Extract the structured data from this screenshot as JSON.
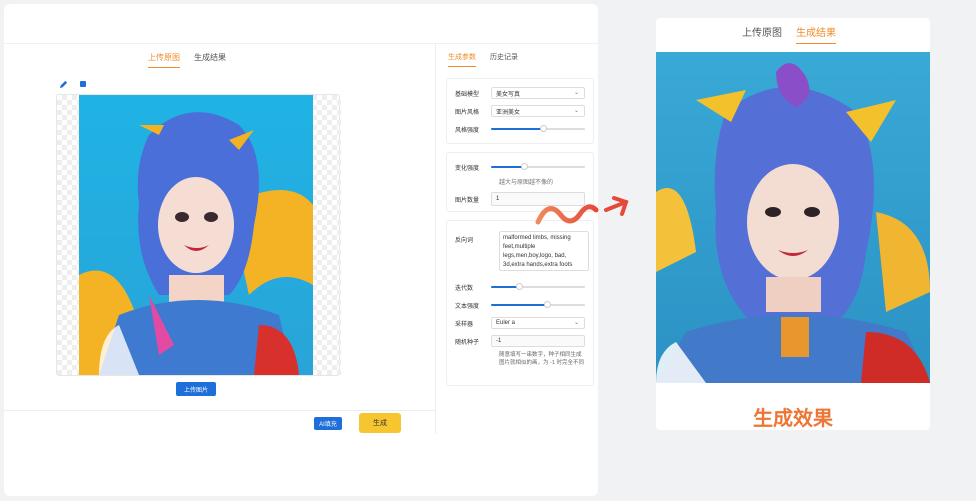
{
  "editor": {
    "tabs": [
      {
        "label": "上传原图",
        "active": true
      },
      {
        "label": "生成结果",
        "active": false
      }
    ],
    "tools": [
      {
        "icon": "pencil-icon"
      },
      {
        "icon": "stop-square-icon"
      }
    ],
    "upload_label": "上传图片",
    "ai_fill_label": "AI填充",
    "generate_label": "生成"
  },
  "params": {
    "tabs": [
      {
        "label": "生成参数",
        "active": true
      },
      {
        "label": "历史记录",
        "active": false
      }
    ],
    "base_model": {
      "label": "基础模型",
      "value": "美女写真"
    },
    "image_style": {
      "label": "图片风格",
      "value": "亚洲美女"
    },
    "style_strength": {
      "label": "风格强度",
      "level": 0.55
    },
    "change_strength": {
      "label": "变化强度",
      "level": 0.35,
      "hint": "越大与原图越不像的"
    },
    "image_count": {
      "label": "图片数量",
      "value": "1"
    },
    "negative_prompt": {
      "label": "反向词",
      "value": "malformed limbs, missing feet,multiple legs,men,boy,logo, bad, 3d,extra hands,extra foots"
    },
    "iterations": {
      "label": "迭代数",
      "level": 0.3
    },
    "text_strength": {
      "label": "文本强度",
      "level": 0.6
    },
    "sampler": {
      "label": "采样器",
      "value": "Euler a"
    },
    "seed": {
      "label": "随机种子",
      "value": "-1",
      "hint": "随意填写一串数字，种子相同生成图片就相似的画，为 -1 时完全不同"
    }
  },
  "result": {
    "tabs": [
      {
        "label": "上传原图",
        "active": false
      },
      {
        "label": "生成结果",
        "active": true
      }
    ],
    "caption": "生成效果"
  },
  "colors": {
    "accent": "#f08c2a",
    "primary": "#1e6fd9",
    "generate": "#f7c530",
    "caption": "#ee7634"
  }
}
